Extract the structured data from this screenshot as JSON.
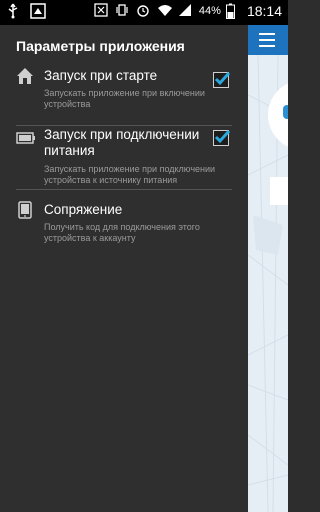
{
  "status_bar": {
    "battery_percent": "44%",
    "time": "18:14"
  },
  "drawer": {
    "title": "Параметры приложения",
    "items": [
      {
        "label": "Запуск при старте",
        "description": "Запускать приложение при включении устройства",
        "icon": "home-icon",
        "checked": true
      },
      {
        "label": "Запуск при подключении питания",
        "description": "Запускать приложение при подключении устройства к источнику питания",
        "icon": "battery-icon",
        "checked": true
      },
      {
        "label": "Сопряжение",
        "description": "Получить код для подключения этого устройства к аккаунту",
        "icon": "tablet-icon"
      }
    ]
  },
  "colors": {
    "drawer_bg": "#2f2f2f",
    "accent": "#1e73be",
    "check": "#29a8e0"
  }
}
